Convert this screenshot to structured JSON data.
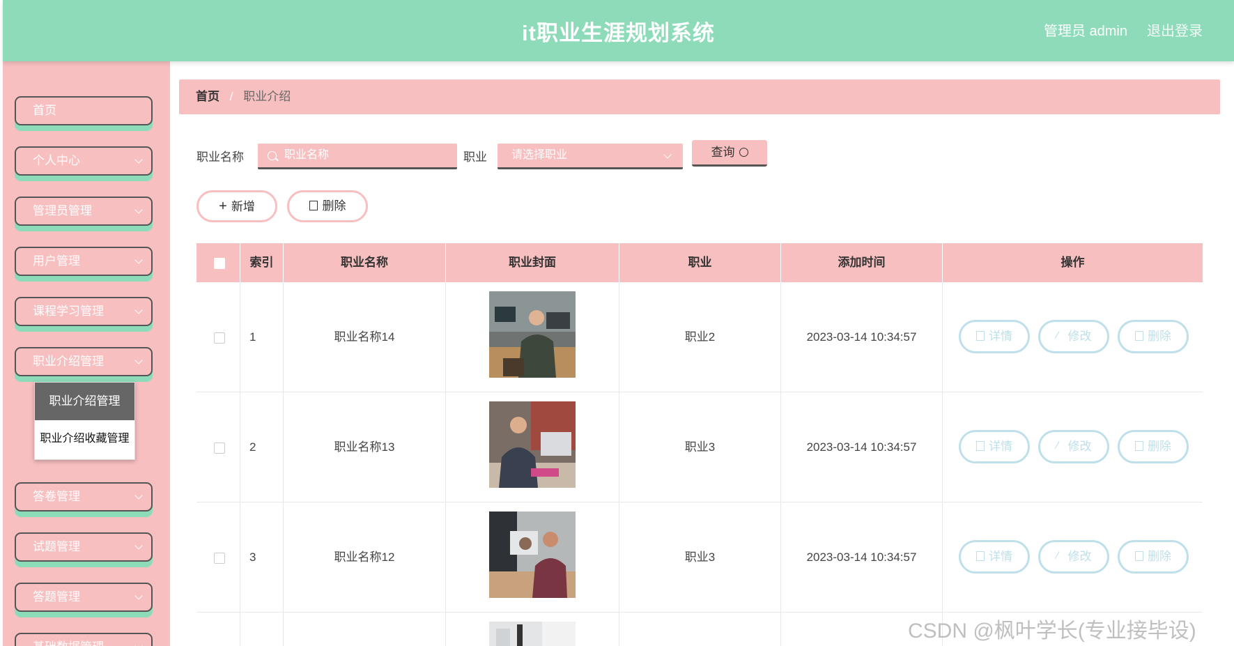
{
  "header": {
    "title": "it职业生涯规划系统",
    "user": "管理员 admin",
    "logout": "退出登录"
  },
  "sidebar": {
    "items": [
      {
        "label": "首页",
        "has_children": false
      },
      {
        "label": "个人中心",
        "has_children": true
      },
      {
        "label": "管理员管理",
        "has_children": true
      },
      {
        "label": "用户管理",
        "has_children": true
      },
      {
        "label": "课程学习管理",
        "has_children": true
      },
      {
        "label": "职业介绍管理",
        "has_children": true
      },
      {
        "label": "答卷管理",
        "has_children": true
      },
      {
        "label": "试题管理",
        "has_children": true
      },
      {
        "label": "答题管理",
        "has_children": true
      },
      {
        "label": "基础数据管理",
        "has_children": true
      }
    ],
    "submenu": [
      {
        "label": "职业介绍管理",
        "active": true
      },
      {
        "label": "职业介绍收藏管理",
        "active": false
      }
    ]
  },
  "breadcrumb": {
    "home": "首页",
    "separator": "/",
    "current": "职业介绍"
  },
  "search": {
    "name_label": "职业名称",
    "name_placeholder": "职业名称",
    "job_label": "职业",
    "job_placeholder": "请选择职业",
    "query_label": "查询"
  },
  "actions": {
    "add_label": "新增",
    "delete_label": "删除"
  },
  "table": {
    "headers": [
      "索引",
      "职业名称",
      "职业封面",
      "职业",
      "添加时间",
      "操作"
    ],
    "row_actions": {
      "detail": "详情",
      "edit": "修改",
      "delete": "删除"
    },
    "rows": [
      {
        "index": "1",
        "name": "职业名称14",
        "job": "职业2",
        "time": "2023-03-14 10:34:57"
      },
      {
        "index": "2",
        "name": "职业名称13",
        "job": "职业3",
        "time": "2023-03-14 10:34:57"
      },
      {
        "index": "3",
        "name": "职业名称12",
        "job": "职业3",
        "time": "2023-03-14 10:34:57"
      }
    ]
  },
  "watermark": "CSDN @枫叶学长(专业接毕设)",
  "colors": {
    "header": "#8ddbb8",
    "accent": "#f7bfc0",
    "action_border": "#bfe0ea"
  }
}
